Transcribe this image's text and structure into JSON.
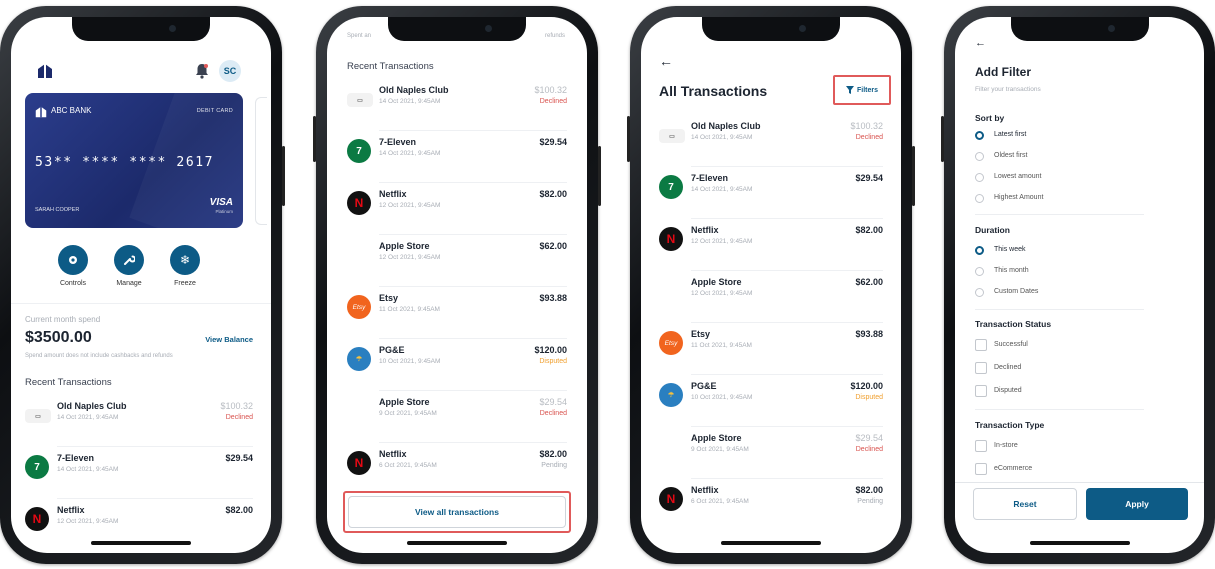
{
  "colors": {
    "brand": "#0d5b86",
    "card": "#253681",
    "declined": "#d9534f",
    "disputed": "#f0a030",
    "highlight_box": "#e05a5a"
  },
  "phone1": {
    "user_initials": "SC",
    "card": {
      "bank_name": "ABC BANK",
      "card_type": "DEBIT CARD",
      "number": "53** **** **** 2617",
      "holder": "SARAH COOPER",
      "network": "VISA",
      "network_sub": "Platinum"
    },
    "actions": [
      {
        "label": "Controls",
        "icon": "gear-icon"
      },
      {
        "label": "Manage",
        "icon": "wrench-icon"
      },
      {
        "label": "Freeze",
        "icon": "snowflake-icon"
      }
    ],
    "spend": {
      "label": "Current month spend",
      "amount": "$3500.00",
      "link": "View Balance",
      "note": "Spend amount does not include cashbacks and refunds"
    },
    "recent_title": "Recent Transactions",
    "transactions": [
      {
        "name": "Old Naples Club",
        "date": "14 Oct 2021, 9:45AM",
        "amount": "$100.32",
        "status": "Declined",
        "logo": "naples-logo"
      },
      {
        "name": "7-Eleven",
        "date": "14 Oct 2021, 9:45AM",
        "amount": "$29.54",
        "status": "",
        "logo": "7eleven-logo"
      },
      {
        "name": "Netflix",
        "date": "12 Oct 2021, 9:45AM",
        "amount": "$82.00",
        "status": "",
        "logo": "netflix-logo"
      }
    ]
  },
  "phone2": {
    "status_left": "Spent an",
    "status_right": "refunds",
    "recent_title": "Recent Transactions",
    "transactions": [
      {
        "name": "Old Naples Club",
        "date": "14 Oct 2021, 9:45AM",
        "amount": "$100.32",
        "status": "Declined",
        "logo": "naples-logo"
      },
      {
        "name": "7-Eleven",
        "date": "14 Oct 2021, 9:45AM",
        "amount": "$29.54",
        "status": "",
        "logo": "7eleven-logo"
      },
      {
        "name": "Netflix",
        "date": "12 Oct 2021, 9:45AM",
        "amount": "$82.00",
        "status": "",
        "logo": "netflix-logo"
      },
      {
        "name": "Apple Store",
        "date": "12 Oct 2021, 9:45AM",
        "amount": "$62.00",
        "status": "",
        "logo": "apple-logo"
      },
      {
        "name": "Etsy",
        "date": "11 Oct 2021, 9:45AM",
        "amount": "$93.88",
        "status": "",
        "logo": "etsy-logo"
      },
      {
        "name": "PG&E",
        "date": "10 Oct 2021, 9:45AM",
        "amount": "$120.00",
        "status": "Disputed",
        "logo": "pge-logo"
      },
      {
        "name": "Apple Store",
        "date": "9 Oct 2021, 9:45AM",
        "amount": "$29.54",
        "status": "Declined",
        "logo": "apple-logo"
      },
      {
        "name": "Netflix",
        "date": "6 Oct 2021, 9:45AM",
        "amount": "$82.00",
        "status": "Pending",
        "logo": "netflix-logo"
      }
    ],
    "view_all": "View all transactions"
  },
  "phone3": {
    "title": "All Transactions",
    "filters_label": "Filters",
    "transactions": [
      {
        "name": "Old Naples Club",
        "date": "14 Oct 2021, 9:45AM",
        "amount": "$100.32",
        "status": "Declined",
        "logo": "naples-logo"
      },
      {
        "name": "7-Eleven",
        "date": "14 Oct 2021, 9:45AM",
        "amount": "$29.54",
        "status": "",
        "logo": "7eleven-logo"
      },
      {
        "name": "Netflix",
        "date": "12 Oct 2021, 9:45AM",
        "amount": "$82.00",
        "status": "",
        "logo": "netflix-logo"
      },
      {
        "name": "Apple Store",
        "date": "12 Oct 2021, 9:45AM",
        "amount": "$62.00",
        "status": "",
        "logo": "apple-logo"
      },
      {
        "name": "Etsy",
        "date": "11 Oct 2021, 9:45AM",
        "amount": "$93.88",
        "status": "",
        "logo": "etsy-logo"
      },
      {
        "name": "PG&E",
        "date": "10 Oct 2021, 9:45AM",
        "amount": "$120.00",
        "status": "Disputed",
        "logo": "pge-logo"
      },
      {
        "name": "Apple Store",
        "date": "9 Oct 2021, 9:45AM",
        "amount": "$29.54",
        "status": "Declined",
        "logo": "apple-logo"
      },
      {
        "name": "Netflix",
        "date": "6 Oct 2021, 9:45AM",
        "amount": "$82.00",
        "status": "Pending",
        "logo": "netflix-logo"
      }
    ]
  },
  "phone4": {
    "title": "Add Filter",
    "subtitle": "Filter your transactions",
    "sort_by": {
      "title": "Sort by",
      "options": [
        "Latest first",
        "Oldest first",
        "Lowest amount",
        "Highest Amount"
      ],
      "selected": "Latest first"
    },
    "duration": {
      "title": "Duration",
      "options": [
        "This week",
        "This month",
        "Custom Dates"
      ],
      "selected": "This week"
    },
    "status": {
      "title": "Transaction Status",
      "options": [
        "Successful",
        "Declined",
        "Disputed"
      ]
    },
    "type": {
      "title": "Transaction Type",
      "options": [
        "In-store",
        "eCommerce"
      ]
    },
    "reset_label": "Reset",
    "apply_label": "Apply"
  }
}
